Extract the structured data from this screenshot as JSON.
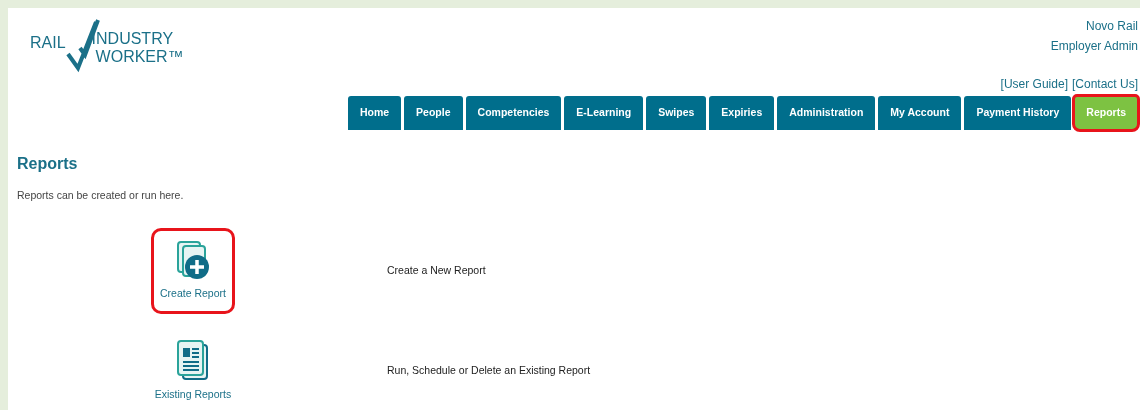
{
  "logo": {
    "line_1_left": "RAIL",
    "line_1_right": "INDUSTRY",
    "line_2": "WORKER™"
  },
  "user": {
    "company": "Novo Rail",
    "role": "Employer Admin"
  },
  "top_links": [
    "[User Guide]",
    "[Contact Us]"
  ],
  "tabs": [
    {
      "label": "Home",
      "selected": false,
      "highlighted": false
    },
    {
      "label": "People",
      "selected": false,
      "highlighted": false
    },
    {
      "label": "Competencies",
      "selected": false,
      "highlighted": false
    },
    {
      "label": "E-Learning",
      "selected": false,
      "highlighted": false
    },
    {
      "label": "Swipes",
      "selected": false,
      "highlighted": false
    },
    {
      "label": "Expiries",
      "selected": false,
      "highlighted": false
    },
    {
      "label": "Administration",
      "selected": false,
      "highlighted": false
    },
    {
      "label": "My Account",
      "selected": false,
      "highlighted": false
    },
    {
      "label": "Payment History",
      "selected": false,
      "highlighted": false
    },
    {
      "label": "Reports",
      "selected": true,
      "highlighted": true
    }
  ],
  "page": {
    "title": "Reports",
    "intro": "Reports can be created or run here."
  },
  "reports": [
    {
      "kind": "create",
      "label": "Create Report",
      "description": "Create a New Report",
      "highlighted": true
    },
    {
      "kind": "existing",
      "label": "Existing Reports",
      "description": "Run, Schedule or Delete an Existing Report",
      "highlighted": false
    }
  ]
}
